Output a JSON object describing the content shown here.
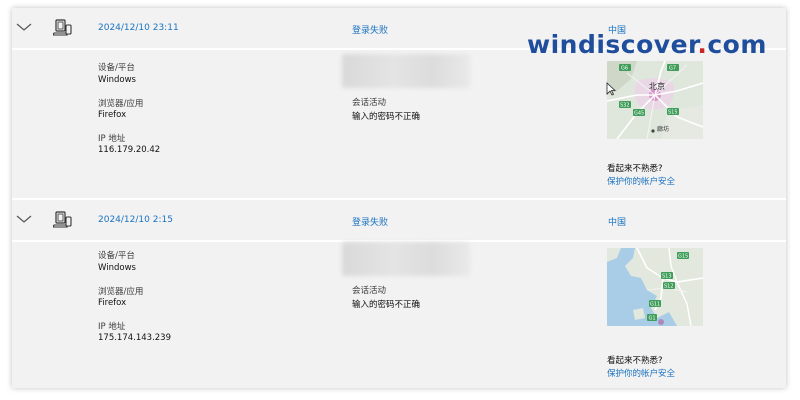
{
  "watermark": {
    "part1": "windiscover",
    "dot": ".",
    "part2": "com"
  },
  "entries": [
    {
      "timestamp": "2024/12/10 23:11",
      "result": "登录失败",
      "location": "中国",
      "device_label": "设备/平台",
      "device_value": "Windows",
      "browser_label": "浏览器/应用",
      "browser_value": "Firefox",
      "ip_label": "IP 地址",
      "ip_value": "116.179.20.42",
      "session_label": "会话活动",
      "session_value": "输入的密码不正确",
      "map": {
        "city_label": "北京",
        "district_label": "廊坊",
        "roads": [
          "G6",
          "G7",
          "G45",
          "S15",
          "S32"
        ]
      },
      "question": "看起来不熟悉?",
      "protect_link": "保护你的帐户安全"
    },
    {
      "timestamp": "2024/12/10 2:15",
      "result": "登录失败",
      "location": "中国",
      "device_label": "设备/平台",
      "device_value": "Windows",
      "browser_label": "浏览器/应用",
      "browser_value": "Firefox",
      "ip_label": "IP 地址",
      "ip_value": "175.174.143.239",
      "session_label": "会话活动",
      "session_value": "输入的密码不正确",
      "map": {
        "roads": [
          "G15",
          "S13",
          "S12",
          "G11",
          "G1"
        ]
      },
      "question": "看起来不熟悉?",
      "protect_link": "保护你的帐户安全"
    }
  ],
  "colors": {
    "link": "#1a73c1",
    "panel": "#f2f2f2",
    "separator": "#ffffff",
    "watermark_blue": "#1f4e9c",
    "watermark_red": "#c62828"
  },
  "icons": {
    "expand": "chevron-down-icon",
    "device": "laptop-phone-icon"
  }
}
